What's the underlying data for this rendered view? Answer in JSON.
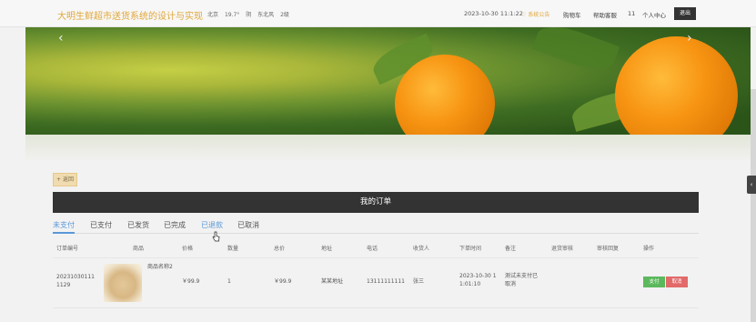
{
  "header": {
    "site_title": "大明生鲜超市送货系统的设计与实现",
    "weather": {
      "city": "北京",
      "temp": "19.7°",
      "condition": "阴",
      "wind": "东北风",
      "level": "2级"
    },
    "datetime": "2023-10-30 11:1:22",
    "notice": "系统公告",
    "nav": {
      "cart": "购物车",
      "help": "帮助客服",
      "count": "11",
      "center": "个人中心"
    },
    "logout": "退出"
  },
  "banner": {
    "prev": "‹",
    "next": "›"
  },
  "side_handle": "‹",
  "back_button": "+ 返回",
  "orders_title": "我的订单",
  "tabs": [
    "未支付",
    "已支付",
    "已发货",
    "已完成",
    "已退款",
    "已取消"
  ],
  "table": {
    "headers": [
      "订单编号",
      "商品",
      "价格",
      "数量",
      "总价",
      "地址",
      "电话",
      "收货人",
      "下单时间",
      "备注",
      "退货审核",
      "审核回复",
      "操作"
    ],
    "rows": [
      {
        "order_no_1": "20231030111",
        "order_no_2": "1129",
        "product_name": "商品名称2",
        "price": "￥99.9",
        "quantity": "1",
        "total": "￥99.9",
        "address": "某某地址",
        "phone": "13111111111",
        "receiver": "张三",
        "time_1": "2023-10-30 1",
        "time_2": "1:01:10",
        "remark_1": "测试未支付已",
        "remark_2": "取消",
        "pay": "支付",
        "cancel": "取消"
      }
    ]
  }
}
